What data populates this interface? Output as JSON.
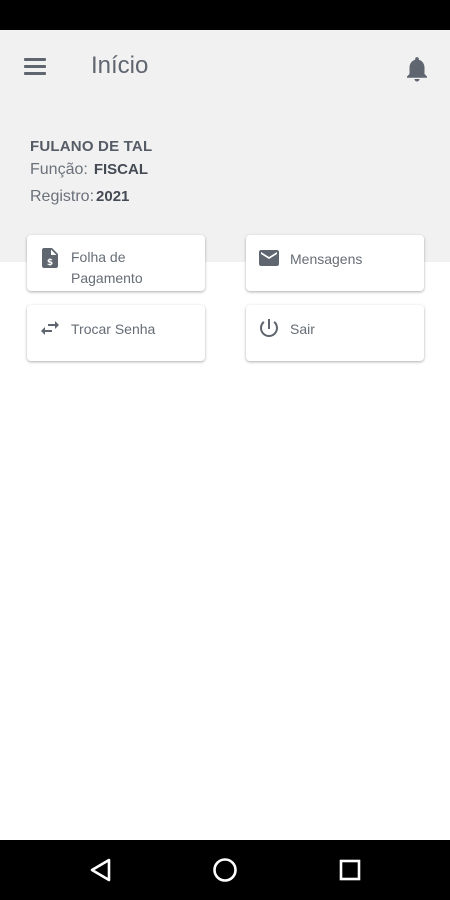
{
  "header": {
    "title": "Início",
    "menu_icon": "menu-icon",
    "notification_icon": "bell-icon"
  },
  "user": {
    "name": "FULANO DE TAL",
    "funcao_label": "Função:",
    "funcao_value": "FISCAL",
    "registro_label": "Registro:",
    "registro_value": "2021"
  },
  "cards": {
    "folha": {
      "label": "Folha de Pagamento",
      "icon": "payslip-icon"
    },
    "mensagens": {
      "label": "Mensagens",
      "icon": "envelope-icon"
    },
    "trocar_senha": {
      "label": "Trocar Senha",
      "icon": "swap-arrows-icon"
    },
    "sair": {
      "label": "Sair",
      "icon": "power-icon"
    }
  },
  "navigation": {
    "back_icon": "back-triangle-icon",
    "home_icon": "home-circle-icon",
    "recents_icon": "recents-square-icon"
  },
  "colors": {
    "header_bg": "#f1f1f1",
    "icon_gray": "#5f6670",
    "system_bar": "#000000"
  }
}
